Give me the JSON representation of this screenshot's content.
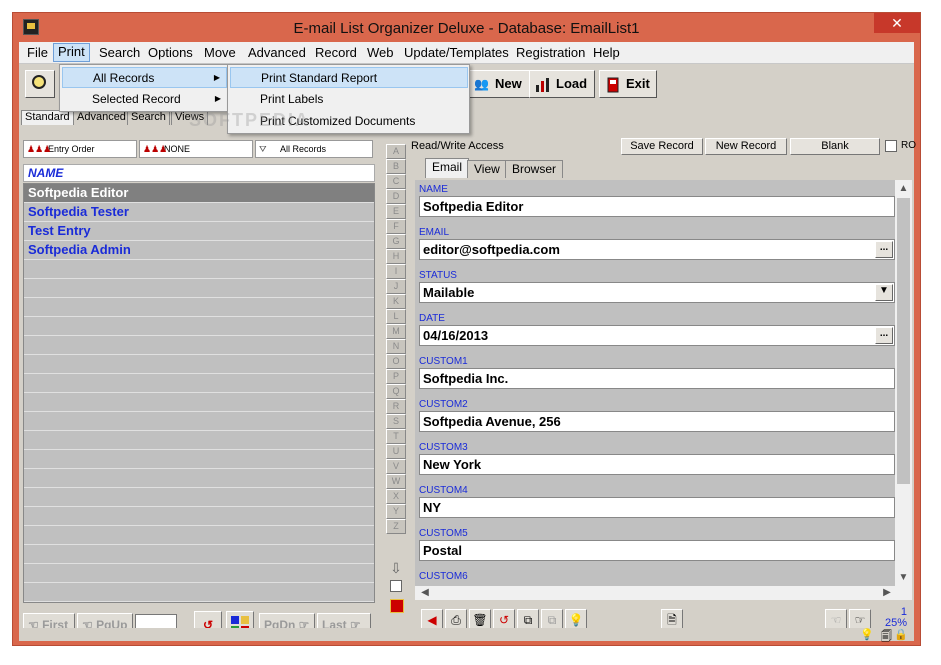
{
  "window": {
    "title": "E-mail List Organizer Deluxe - Database: EmailList1",
    "close_glyph": "✕"
  },
  "menubar": {
    "items": [
      "File",
      "Print",
      "Search",
      "Options",
      "Move",
      "Advanced",
      "Record",
      "Web",
      "Update/Templates",
      "Registration",
      "Help"
    ]
  },
  "print_menu": {
    "items": [
      {
        "label": "All Records",
        "has_submenu": true
      },
      {
        "label": "Selected Record",
        "has_submenu": true
      }
    ],
    "submenu": [
      "Print Standard Report",
      "Print Labels",
      "Print Customized Documents"
    ]
  },
  "toolbar": {
    "new_label": "New",
    "load_label": "Load",
    "exit_label": "Exit"
  },
  "left_tabs": [
    "Standard",
    "Advanced",
    "Search",
    "Views"
  ],
  "sort_buttons": [
    "Entry Order",
    "NONE",
    "All Records"
  ],
  "list": {
    "header": "NAME",
    "records": [
      "Softpedia Editor",
      "Softpedia Tester",
      "Test Entry",
      "Softpedia Admin"
    ],
    "selected_index": 0
  },
  "nav": {
    "first": "First",
    "pgup": "PgUp",
    "pgdn": "PgDn",
    "last": "Last"
  },
  "alphabet": [
    "A",
    "B",
    "C",
    "D",
    "E",
    "F",
    "G",
    "H",
    "I",
    "J",
    "K",
    "L",
    "M",
    "N",
    "O",
    "P",
    "Q",
    "R",
    "S",
    "T",
    "U",
    "V",
    "W",
    "X",
    "Y",
    "Z"
  ],
  "record_panel": {
    "access_label": "Read/Write Access",
    "save_label": "Save Record",
    "new_label": "New Record",
    "blank_label": "Blank",
    "ro_label": "RO",
    "tabs": [
      "Email",
      "View",
      "Browser"
    ],
    "fields": [
      {
        "label": "NAME",
        "value": "Softpedia Editor",
        "button": ""
      },
      {
        "label": "EMAIL",
        "value": "editor@softpedia.com",
        "button": "..."
      },
      {
        "label": "STATUS",
        "value": "Mailable",
        "button": "▼"
      },
      {
        "label": "DATE",
        "value": "04/16/2013",
        "button": "..."
      },
      {
        "label": "CUSTOM1",
        "value": "Softpedia Inc.",
        "button": ""
      },
      {
        "label": "CUSTOM2",
        "value": "Softpedia Avenue, 256",
        "button": ""
      },
      {
        "label": "CUSTOM3",
        "value": "New York",
        "button": ""
      },
      {
        "label": "CUSTOM4",
        "value": "NY",
        "button": ""
      },
      {
        "label": "CUSTOM5",
        "value": "Postal",
        "button": ""
      },
      {
        "label": "CUSTOM6",
        "value": "",
        "button": ""
      }
    ]
  },
  "position": {
    "record_number": "1",
    "percent": "25%"
  },
  "watermark": "SOFTPEDIA"
}
